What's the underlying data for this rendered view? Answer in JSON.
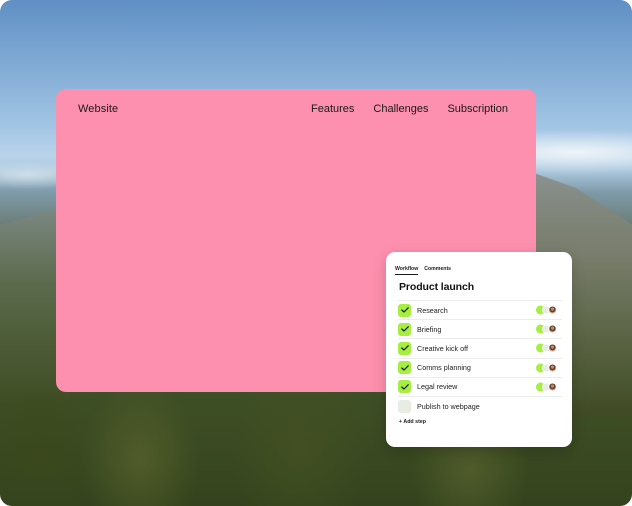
{
  "website": {
    "brand": "Website",
    "nav": [
      "Features",
      "Challenges",
      "Subscription"
    ],
    "card_color": "#fd90ae"
  },
  "workflow": {
    "tabs": [
      "Workflow",
      "Comments"
    ],
    "active_tab": "Workflow",
    "title": "Product launch",
    "accent_color": "#a6ee41",
    "steps": [
      {
        "label": "Research",
        "done": true
      },
      {
        "label": "Briefing",
        "done": true
      },
      {
        "label": "Creative kick off",
        "done": true
      },
      {
        "label": "Comms planning",
        "done": true
      },
      {
        "label": "Legal review",
        "done": true
      },
      {
        "label": "Publish to webpage",
        "done": false
      }
    ],
    "add_step_label": "+ Add step",
    "icons": {
      "check": "check-icon",
      "avatar": "avatar-icon"
    }
  }
}
